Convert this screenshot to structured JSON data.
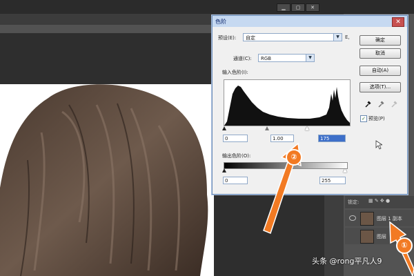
{
  "dialog": {
    "title": "色阶",
    "close_label": "✕",
    "preset_label": "预设(E):",
    "preset_value": "自定",
    "preset_icon": "E,",
    "channel_label": "通道(C):",
    "channel_value": "RGB",
    "input_levels_label": "输入色阶(I):",
    "output_levels_label": "输出色阶(O):",
    "input_shadow": "0",
    "input_gamma": "1.00",
    "input_highlight": "175",
    "output_shadow": "0",
    "output_highlight": "255",
    "buttons": {
      "ok": "确定",
      "cancel": "取消",
      "auto": "自动(A)",
      "options": "选项(T)..."
    },
    "preview_label": "预览(P)",
    "preview_checked": true
  },
  "layers": {
    "lock_label": "锁定:",
    "rows": [
      {
        "name": "图层 1 副本"
      },
      {
        "name": "图层"
      }
    ]
  },
  "markers": {
    "one": "①",
    "two": "②"
  },
  "watermark": "头条 @rong平凡人9",
  "colors": {
    "accent": "#f27a23",
    "dialog_title": "#c6d9f1",
    "close_button": "#c75050",
    "selection": "#3d6fc9"
  }
}
